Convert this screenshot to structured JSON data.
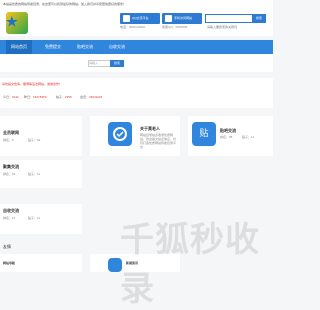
{
  "notice": "本站是优质的网站导航目录，在这里可以找到最好的网站。加入我们并享受更快更好的服务！",
  "header": {
    "phone_btn_1": "QQ交流平台",
    "phone_btn_2": "手机访问网站",
    "sub_label_1": "电话：0000-00000",
    "sub_label_2": "客服QQ：0000000",
    "search_placeholder": "请输入要搜索的关键词",
    "search_button": "搜索"
  },
  "nav": {
    "items": [
      {
        "label": "网站首页"
      },
      {
        "label": "免费提交"
      },
      {
        "label": "贴吧交流"
      },
      {
        "label": "自收交流"
      }
    ]
  },
  "subsearch": {
    "placeholder": "请输入",
    "button": "搜索"
  },
  "info": {
    "warning": "请勿提交色情、赌博等违法网站，谢谢合作！",
    "stats": [
      {
        "label": "今日：",
        "value": "3132"
      },
      {
        "label": "昨日：",
        "value": "15478459"
      },
      {
        "label": "帖子：",
        "value": "2355"
      },
      {
        "label": "会员：",
        "value": "43041193"
      }
    ]
  },
  "cards": [
    {
      "title": "全员联网",
      "rank_label": "排名：",
      "rank": "5",
      "meta": "贴子：82"
    },
    {
      "title": "关于莫老人",
      "desc": "网站目录站点收录优质网站，欢迎提交站点信息，共同打造优质网站导航目录平台",
      "rank_label": "",
      "rank": "",
      "meta": ""
    },
    {
      "title": "贴吧交流",
      "rank_label": "排名：",
      "rank": "98",
      "meta": "贴子：11"
    },
    {
      "title": "聚集交流",
      "rank_label": "排名：",
      "rank": "62",
      "meta": "贴子：11"
    },
    {
      "title": "自收交流",
      "rank_label": "排名：",
      "rank": "17",
      "meta": "贴子：11"
    }
  ],
  "section_label": "友情",
  "bottom": [
    {
      "title": "网站导航"
    },
    {
      "title": "新闻资讯"
    }
  ],
  "watermark": "千狐秒收录",
  "colors": {
    "accent": "#2f86dc",
    "warning": "#e0302a",
    "tag": "#f08a3a"
  }
}
